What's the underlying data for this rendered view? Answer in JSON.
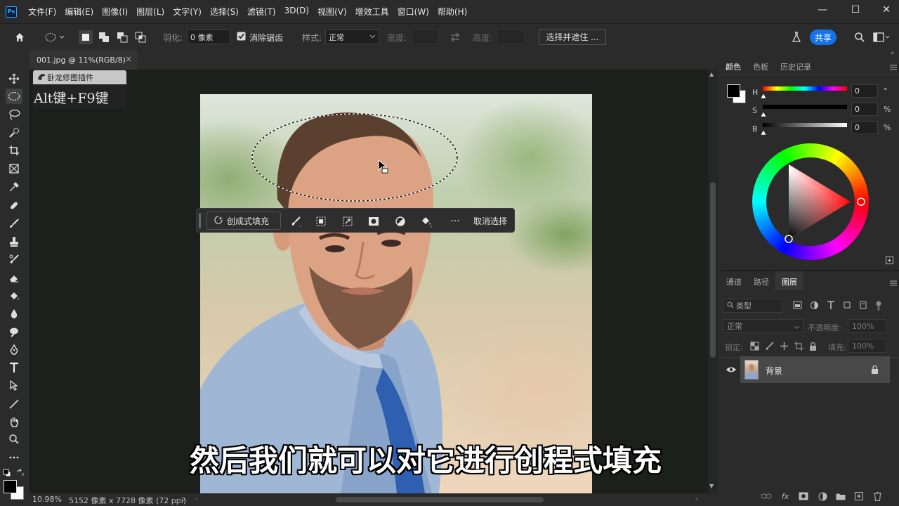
{
  "app": {
    "logo": "Ps"
  },
  "menu": [
    "文件(F)",
    "编辑(E)",
    "图像(I)",
    "图层(L)",
    "文字(Y)",
    "选择(S)",
    "滤镜(T)",
    "3D(D)",
    "视图(V)",
    "增效工具",
    "窗口(W)",
    "帮助(H)"
  ],
  "window_controls": {
    "minimize": "—",
    "maximize": "☐",
    "close": "✕"
  },
  "options": {
    "feather_label": "羽化:",
    "feather_value": "0 像素",
    "antialias_label": "消除锯齿",
    "antialias_checked": true,
    "style_label": "样式:",
    "style_value": "正常",
    "width_label": "宽度:",
    "height_label": "高度:",
    "select_mask_label": "选择并遮住 ...",
    "share_label": "共享"
  },
  "document": {
    "tab_title": "001.jpg @ 11%(RGB/8)",
    "tab_close": "×"
  },
  "plugin": {
    "name": "卧龙修图插件",
    "shortcut": "Alt键+F9键"
  },
  "taskbar": {
    "generative_fill": "创成式填充",
    "more": "···",
    "deselect": "取消选择"
  },
  "subtitle": "然后我们就可以对它进行创程式填充",
  "status": {
    "zoom": "10.98%",
    "doc_size": "5152 像素 x 7728 像素 (72 ppi)",
    "arrow": "›"
  },
  "color_panel": {
    "tabs": [
      "颜色",
      "色板",
      "历史记录"
    ],
    "active_tab": "颜色",
    "h_label": "H",
    "s_label": "S",
    "b_label": "B",
    "h_value": "0",
    "s_value": "0",
    "b_value": "0",
    "h_unit": "°",
    "s_unit": "%",
    "b_unit": "%",
    "foreground": "#000000",
    "background": "#ffffff",
    "hue_marker": "#ff0000"
  },
  "layers_panel": {
    "tabs": [
      "通道",
      "路径",
      "图层"
    ],
    "active_tab": "图层",
    "filter_label": "类型",
    "blend_mode": "正常",
    "opacity_label": "不透明度:",
    "opacity_value": "100%",
    "lock_label": "锁定:",
    "fill_label": "填充:",
    "fill_value": "100%",
    "layers": [
      {
        "name": "背景",
        "visible": true,
        "locked": true
      }
    ]
  },
  "colors": {
    "accent": "#1473e6",
    "panel": "#2b2b2b",
    "app_bg": "#1c1c1c"
  }
}
